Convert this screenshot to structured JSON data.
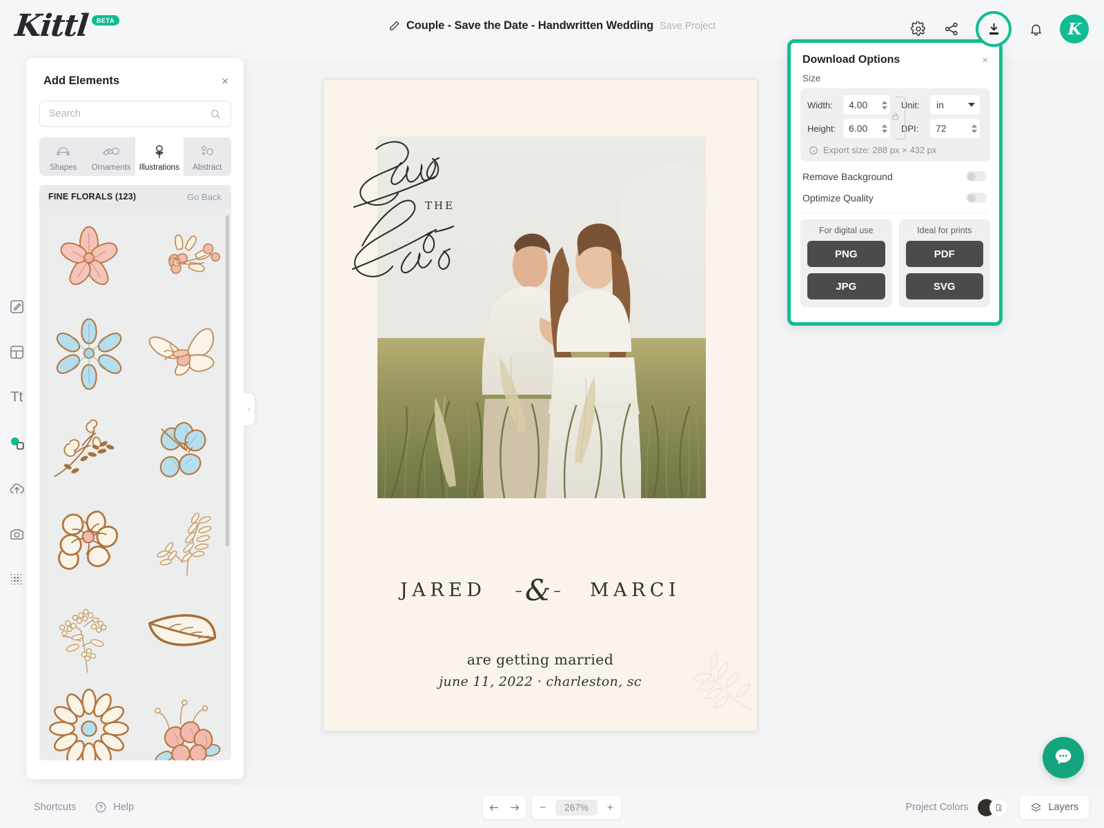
{
  "brand": {
    "name": "Kittl",
    "badge": "BETA",
    "accent": "#12bc93"
  },
  "header": {
    "doc_title": "Couple - Save the Date - Handwritten Wedding",
    "save_project": "Save Project",
    "icons": [
      "pencil-icon",
      "gear-icon",
      "share-icon",
      "download-icon",
      "bell-icon"
    ],
    "avatar_letter": "K"
  },
  "left_rail": {
    "items": [
      {
        "name": "edit-icon",
        "active": false
      },
      {
        "name": "templates-icon",
        "active": false
      },
      {
        "name": "text-icon",
        "active": false
      },
      {
        "name": "elements-icon",
        "active": true
      },
      {
        "name": "upload-icon",
        "active": false
      },
      {
        "name": "photos-icon",
        "active": false
      },
      {
        "name": "grid-icon",
        "active": false
      }
    ]
  },
  "elements_panel": {
    "title": "Add Elements",
    "close_label": "×",
    "search": {
      "placeholder": "Search",
      "value": ""
    },
    "tabs": [
      {
        "label": "Shapes",
        "icon": "shapes-icon",
        "active": false
      },
      {
        "label": "Ornaments",
        "icon": "ornaments-icon",
        "active": false
      },
      {
        "label": "Illustrations",
        "icon": "illustrations-icon",
        "active": true
      },
      {
        "label": "Abstract",
        "icon": "abstract-icon",
        "active": false
      }
    ],
    "collection": {
      "name": "FINE FLORALS (123)",
      "go_back": "Go Back"
    },
    "assets": [
      {
        "name": "pink-five-petal-flower"
      },
      {
        "name": "pink-blossom-sprig"
      },
      {
        "name": "blue-six-petal-flower"
      },
      {
        "name": "cream-butterfly"
      },
      {
        "name": "rose-bud-branch"
      },
      {
        "name": "blue-hibiscus"
      },
      {
        "name": "cream-poppy-flower"
      },
      {
        "name": "fern-leaf-sprig"
      },
      {
        "name": "berry-branch"
      },
      {
        "name": "large-leaf"
      },
      {
        "name": "cream-daisy"
      },
      {
        "name": "pink-peony-bloom"
      }
    ]
  },
  "canvas": {
    "design": {
      "script_line1": "Save",
      "script_mid": "THE",
      "script_line2": "Date",
      "name_left": "JARED",
      "ampersand": "&",
      "dash": "–",
      "name_right": "MARCI",
      "married_line": "are getting married",
      "date_line": "june 11, 2022 · charleston, sc",
      "bg_color": "#faf4ec",
      "ink_color": "#33312e"
    }
  },
  "download_panel": {
    "title": "Download Options",
    "close_label": "×",
    "size_label": "Size",
    "fields": {
      "width_label": "Width:",
      "width_value": "4.00",
      "height_label": "Height:",
      "height_value": "6.00",
      "unit_label": "Unit:",
      "unit_value": "in",
      "dpi_label": "DPI:",
      "dpi_value": "72"
    },
    "export_note": "Export size: 288 px × 432 px",
    "toggles": [
      {
        "label": "Remove Background",
        "on": false
      },
      {
        "label": "Optimize Quality",
        "on": false
      }
    ],
    "format_groups": [
      {
        "caption": "For digital use",
        "buttons": [
          "PNG",
          "JPG"
        ]
      },
      {
        "caption": "Ideal for prints",
        "buttons": [
          "PDF",
          "SVG"
        ]
      }
    ]
  },
  "bottom_bar": {
    "shortcuts": "Shortcuts",
    "help": "Help",
    "undo_icon": "undo-icon",
    "redo_icon": "redo-icon",
    "zoom_out": "−",
    "zoom_value": "267%",
    "zoom_in": "+",
    "project_colors": "Project Colors",
    "layers": "Layers"
  }
}
